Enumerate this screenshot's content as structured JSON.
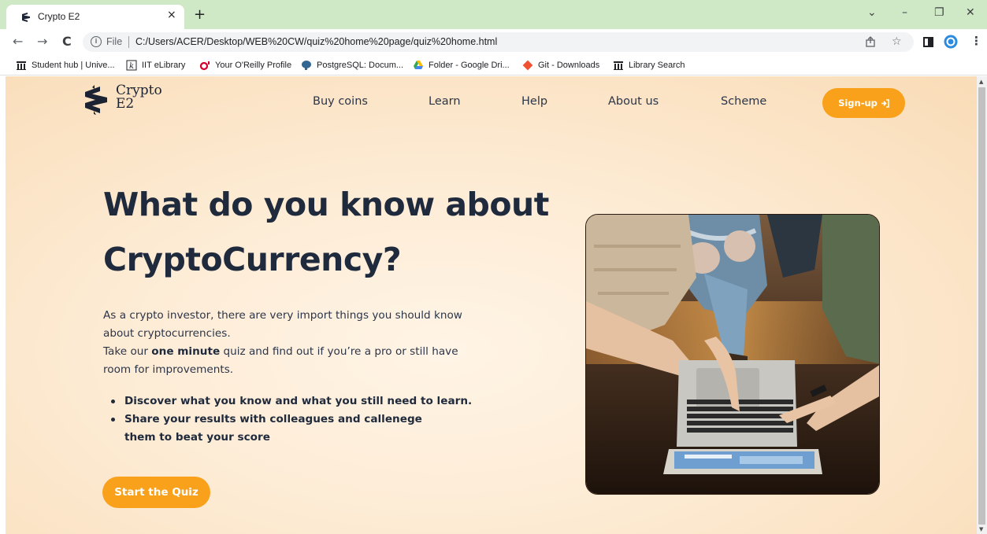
{
  "browser": {
    "tab_title": "Crypto E2",
    "tab_close": "×",
    "new_tab": "+",
    "omnibox_file": "File",
    "url": "C:/Users/ACER/Desktop/WEB%20CW/quiz%20home%20page/quiz%20home.html",
    "bookmarks": [
      {
        "label": "Student hub | Unive...",
        "icon": "building-icon"
      },
      {
        "label": "IIT eLibrary",
        "icon": "k-book-icon"
      },
      {
        "label": "Your O'Reilly Profile",
        "icon": "oreilly-icon"
      },
      {
        "label": "PostgreSQL: Docum...",
        "icon": "elephant-icon"
      },
      {
        "label": "Folder - Google Dri...",
        "icon": "google-drive-icon"
      },
      {
        "label": "Git - Downloads",
        "icon": "git-icon"
      },
      {
        "label": "Library Search",
        "icon": "building-icon"
      }
    ]
  },
  "site": {
    "logo_line1": "Crypto",
    "logo_line2": "E2",
    "nav": [
      "Buy coins",
      "Learn",
      "Help",
      "About us",
      "Scheme"
    ],
    "signup_label": "Sign-up",
    "accent": "#f9a11b",
    "heading_color": "#1f2a3d"
  },
  "hero": {
    "title_line1": "What do you know about",
    "title_line2": "CryptoCurrency?",
    "para1": "As a crypto investor, there are very import things you should know about cryptocurrencies.",
    "para2_before": "Take our ",
    "para2_bold": "one minute",
    "para2_after": " quiz and find out if you’re a pro or still have room for improvements.",
    "bullets": [
      "Discover what you know and what you still need to learn.",
      "Share your results with colleagues and callenege them to beat your score"
    ],
    "cta": "Start the Quiz"
  }
}
